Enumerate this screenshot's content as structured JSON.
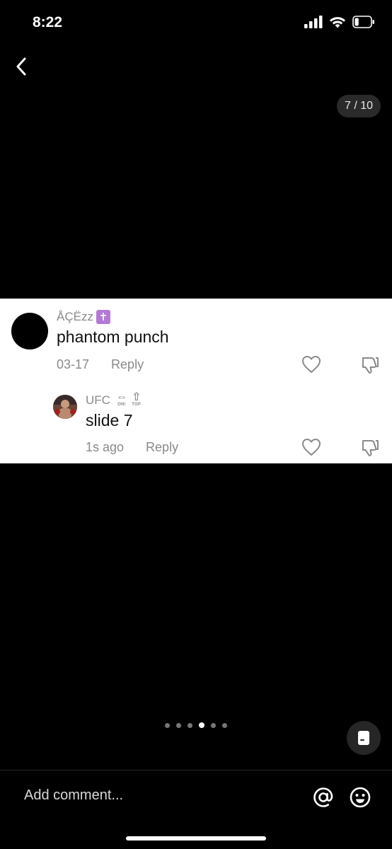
{
  "status_bar": {
    "time": "8:22",
    "battery_level": 0.25
  },
  "viewer": {
    "page_counter": "7 / 10",
    "total_dots": 6,
    "active_dot": 3
  },
  "comments": [
    {
      "username": "ÅÇËzz",
      "badge_icon": "latin-cross-badge-icon",
      "text": "phantom punch",
      "date": "03-17",
      "reply_label": "Reply"
    },
    {
      "username": "UFC",
      "badges": [
        {
          "icon": "left-right-arrow-icon",
          "tag": "ON!"
        },
        {
          "icon": "up-arrow-icon",
          "tag": "TOP"
        }
      ],
      "text": "slide 7",
      "date": "1s ago",
      "reply_label": "Reply"
    }
  ],
  "composer": {
    "placeholder": "Add comment..."
  },
  "colors": {
    "badge_purple": "#b27ad6",
    "meta_gray": "#8a8a8a"
  }
}
